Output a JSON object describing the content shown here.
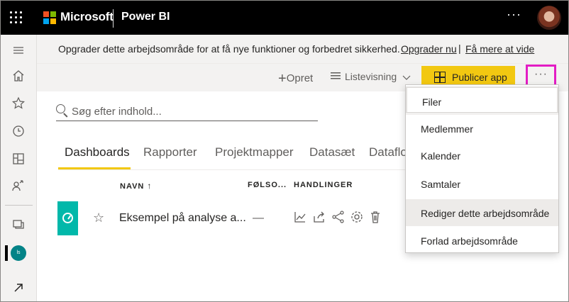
{
  "topbar": {
    "company": "Microsoft",
    "product": "Power BI",
    "more": "···",
    "icons": {
      "app_launcher": "waffle-icon",
      "more": "ellipsis-icon",
      "profile": "avatar"
    }
  },
  "leftnav": {
    "items": [
      {
        "name": "menu-icon"
      },
      {
        "name": "home-icon"
      },
      {
        "name": "favorites-icon"
      },
      {
        "name": "recent-icon"
      },
      {
        "name": "apps-icon"
      },
      {
        "name": "shared-icon"
      },
      {
        "name": "workspaces-icon"
      },
      {
        "name": "get-data-icon"
      }
    ],
    "workspace_badge": "ls"
  },
  "banner": {
    "message": "Opgrader dette arbejdsområde for at få nye funktioner og forbedret sikkerhed.",
    "upgrade_link": "Opgrader nu",
    "separator": "|",
    "learn_link": "Få mere at vide"
  },
  "commandbar": {
    "new_label": "Opret",
    "view_label": "Listevisning",
    "publish_label": "Publicer app",
    "more_label": "···"
  },
  "search": {
    "placeholder": "Søg efter indhold..."
  },
  "tabs": [
    {
      "label": "Dashboards",
      "active": true
    },
    {
      "label": "Rapporter",
      "active": false
    },
    {
      "label": "Projektmapper",
      "active": false
    },
    {
      "label": "Datasæt",
      "active": false
    },
    {
      "label": "Dataflo",
      "active": false
    }
  ],
  "table": {
    "columns": {
      "name": "NAVN",
      "sensitivity": "FØLSO...",
      "actions": "HANDLINGER"
    },
    "rows": [
      {
        "name": "Eksempel på analyse a...",
        "sensitivity": "—"
      }
    ]
  },
  "menu": {
    "items": [
      {
        "label": "Filer"
      },
      {
        "label": "Medlemmer"
      },
      {
        "label": "Kalender"
      },
      {
        "label": "Samtaler"
      },
      {
        "label": "Rediger dette arbejdsområde"
      },
      {
        "label": "Forlad arbejdsområde"
      }
    ]
  },
  "colors": {
    "accent_yellow": "#f2c811",
    "highlight_magenta": "#e31dc4",
    "tile_teal": "#01b8aa",
    "workspace_badge": "#038387"
  }
}
